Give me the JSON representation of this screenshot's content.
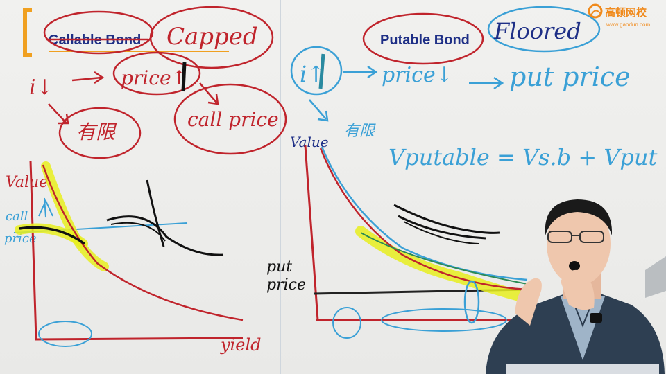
{
  "logo": {
    "name_cn": "高顿网校",
    "url": "www.gaodun.com",
    "color": "#f08a1c"
  },
  "slide": {
    "left_title": "Callable Bond",
    "right_title": "Putable Bond"
  },
  "annotations": {
    "capped": "Capped",
    "floored": "Floored",
    "i_down": "i↓",
    "price_up": "price↑",
    "limited_cn": "有限",
    "call_price": "call price",
    "value_left": "Value",
    "call_abbr": "call",
    "price_abbr": "price",
    "yield_label": "yield",
    "i_up": "i↑",
    "price_down": "price↓",
    "put_price_top": "put price",
    "value_right": "Value",
    "limited_cn2": "有限",
    "formula": "Vputable = Vs.b + Vput",
    "put_label": "put",
    "price_label": "price"
  },
  "colors": {
    "red": "#c0242c",
    "blue": "#3aa0d6",
    "yellow": "#e8ee1f",
    "black": "#141414",
    "navy": "#1e2f86"
  }
}
